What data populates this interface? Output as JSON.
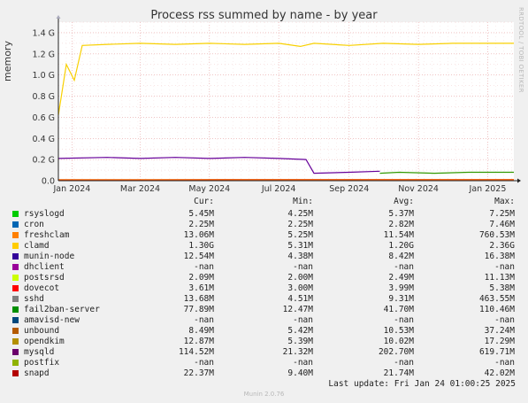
{
  "chart_data": {
    "type": "line",
    "title": "Process rss summed by name - by year",
    "ylabel": "memory",
    "ylim": [
      0,
      1.5
    ],
    "yticks": [
      "0.0",
      "0.2 G",
      "0.4 G",
      "0.6 G",
      "0.8 G",
      "1.0 G",
      "1.2 G",
      "1.4 G"
    ],
    "ytick_values": [
      0,
      0.2,
      0.4,
      0.6,
      0.8,
      1.0,
      1.2,
      1.4
    ],
    "xticks": [
      "Jan 2024",
      "Mar 2024",
      "May 2024",
      "Jul 2024",
      "Sep 2024",
      "Nov 2024",
      "Jan 2025"
    ],
    "xtick_dates": [
      "2024-01-01",
      "2024-03-01",
      "2024-05-01",
      "2024-07-01",
      "2024-09-01",
      "2024-11-01",
      "2025-01-01"
    ],
    "x_start": "2023-12-20",
    "x_end": "2025-01-24",
    "grid": true,
    "series": [
      {
        "name": "clamd",
        "color": "#f8d000",
        "values": [
          [
            0.62,
            "2023-12-20"
          ],
          [
            1.1,
            "2023-12-27"
          ],
          [
            0.95,
            "2024-01-03"
          ],
          [
            1.28,
            "2024-01-10"
          ],
          [
            1.29,
            "2024-02-01"
          ],
          [
            1.3,
            "2024-03-01"
          ],
          [
            1.29,
            "2024-04-01"
          ],
          [
            1.3,
            "2024-05-01"
          ],
          [
            1.29,
            "2024-06-01"
          ],
          [
            1.3,
            "2024-07-01"
          ],
          [
            1.27,
            "2024-07-20"
          ],
          [
            1.3,
            "2024-08-01"
          ],
          [
            1.28,
            "2024-09-01"
          ],
          [
            1.3,
            "2024-10-01"
          ],
          [
            1.29,
            "2024-11-01"
          ],
          [
            1.3,
            "2024-12-01"
          ],
          [
            1.3,
            "2025-01-24"
          ]
        ]
      },
      {
        "name": "mysqld",
        "color": "#660099",
        "values": [
          [
            0.21,
            "2023-12-20"
          ],
          [
            0.22,
            "2024-02-01"
          ],
          [
            0.21,
            "2024-03-01"
          ],
          [
            0.22,
            "2024-04-01"
          ],
          [
            0.21,
            "2024-05-01"
          ],
          [
            0.22,
            "2024-06-01"
          ],
          [
            0.21,
            "2024-07-01"
          ],
          [
            0.2,
            "2024-07-25"
          ],
          [
            0.07,
            "2024-08-01"
          ],
          [
            0.08,
            "2024-09-01"
          ],
          [
            0.09,
            "2024-09-28"
          ]
        ]
      },
      {
        "name": "fail2ban-server",
        "color": "#339900",
        "values": [
          [
            0.07,
            "2024-09-28"
          ],
          [
            0.08,
            "2024-10-15"
          ],
          [
            0.07,
            "2024-11-15"
          ],
          [
            0.08,
            "2024-12-15"
          ],
          [
            0.08,
            "2025-01-24"
          ]
        ]
      },
      {
        "name": "sshd",
        "color": "#cc0000",
        "values": [
          [
            0.005,
            "2023-12-20"
          ],
          [
            0.01,
            "2024-06-01"
          ],
          [
            0.01,
            "2025-01-24"
          ]
        ]
      },
      {
        "name": "freshclam",
        "color": "#ff6600",
        "values": [
          [
            0.01,
            "2023-12-20"
          ],
          [
            0.01,
            "2025-01-24"
          ]
        ]
      }
    ]
  },
  "legend_headers": {
    "cur": "Cur:",
    "min": "Min:",
    "avg": "Avg:",
    "max": "Max:"
  },
  "legend": [
    {
      "name": "rsyslogd",
      "color": "#00cc00",
      "cur": "5.45M",
      "min": "4.25M",
      "avg": "5.37M",
      "max": "7.25M"
    },
    {
      "name": "cron",
      "color": "#0066b3",
      "cur": "2.25M",
      "min": "2.25M",
      "avg": "2.82M",
      "max": "7.46M"
    },
    {
      "name": "freshclam",
      "color": "#ff8000",
      "cur": "13.06M",
      "min": "5.25M",
      "avg": "11.54M",
      "max": "760.53M"
    },
    {
      "name": "clamd",
      "color": "#ffcc00",
      "cur": "1.30G",
      "min": "5.31M",
      "avg": "1.20G",
      "max": "2.36G"
    },
    {
      "name": "munin-node",
      "color": "#330099",
      "cur": "12.54M",
      "min": "4.38M",
      "avg": "8.42M",
      "max": "16.38M"
    },
    {
      "name": "dhclient",
      "color": "#990099",
      "cur": "-nan",
      "min": "-nan",
      "avg": "-nan",
      "max": "-nan"
    },
    {
      "name": "postsrsd",
      "color": "#ccff00",
      "cur": "2.09M",
      "min": "2.00M",
      "avg": "2.49M",
      "max": "11.13M"
    },
    {
      "name": "dovecot",
      "color": "#ff0000",
      "cur": "3.61M",
      "min": "3.00M",
      "avg": "3.99M",
      "max": "5.38M"
    },
    {
      "name": "sshd",
      "color": "#808080",
      "cur": "13.68M",
      "min": "4.51M",
      "avg": "9.31M",
      "max": "463.55M"
    },
    {
      "name": "fail2ban-server",
      "color": "#008f00",
      "cur": "77.89M",
      "min": "12.47M",
      "avg": "41.70M",
      "max": "110.46M"
    },
    {
      "name": "amavisd-new",
      "color": "#00487d",
      "cur": "-nan",
      "min": "-nan",
      "avg": "-nan",
      "max": "-nan"
    },
    {
      "name": "unbound",
      "color": "#b35a00",
      "cur": "8.49M",
      "min": "5.42M",
      "avg": "10.53M",
      "max": "37.24M"
    },
    {
      "name": "opendkim",
      "color": "#b38f00",
      "cur": "12.87M",
      "min": "5.39M",
      "avg": "10.02M",
      "max": "17.29M"
    },
    {
      "name": "mysqld",
      "color": "#6b006b",
      "cur": "114.52M",
      "min": "21.32M",
      "avg": "202.70M",
      "max": "619.71M"
    },
    {
      "name": "postfix",
      "color": "#8fb300",
      "cur": "-nan",
      "min": "-nan",
      "avg": "-nan",
      "max": "-nan"
    },
    {
      "name": "snapd",
      "color": "#b30000",
      "cur": "22.37M",
      "min": "9.40M",
      "avg": "21.74M",
      "max": "42.02M"
    }
  ],
  "side_label": "RRDTOOL / TOBI OETIKER",
  "footer": "Last update: Fri Jan 24 01:00:25 2025",
  "munin_version": "Munin 2.0.76"
}
